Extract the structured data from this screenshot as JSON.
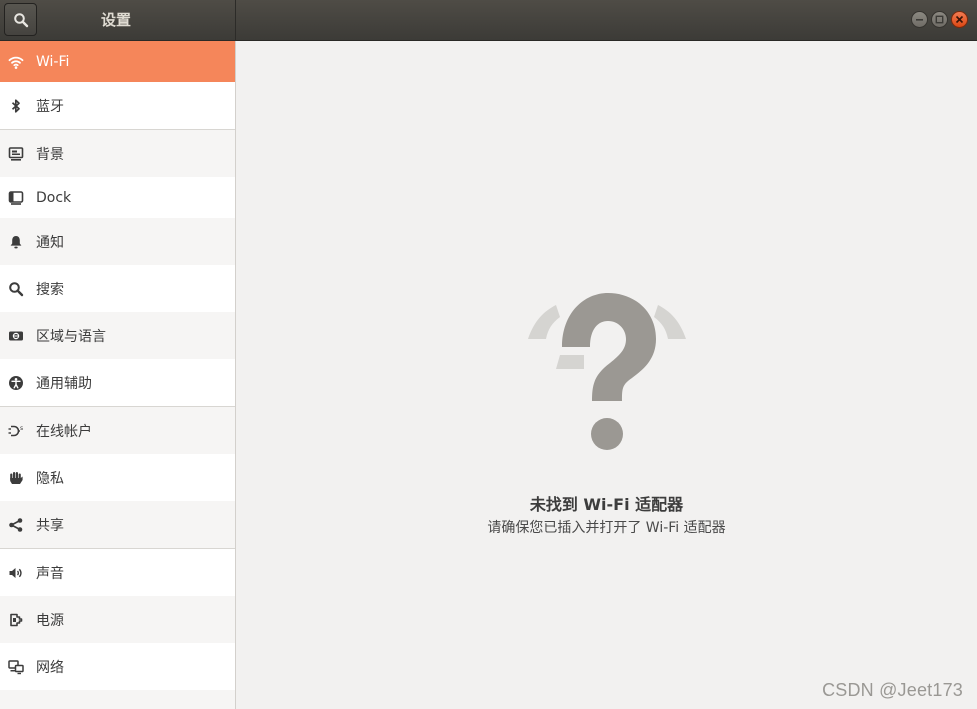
{
  "window": {
    "title": "设置"
  },
  "sidebar": {
    "items": [
      {
        "label": "Wi-Fi",
        "icon": "wifi-icon"
      },
      {
        "label": "蓝牙",
        "icon": "bluetooth-icon"
      },
      {
        "label": "背景",
        "icon": "background-icon"
      },
      {
        "label": "Dock",
        "icon": "dock-icon"
      },
      {
        "label": "通知",
        "icon": "bell-icon"
      },
      {
        "label": "搜索",
        "icon": "search-icon"
      },
      {
        "label": "区域与语言",
        "icon": "region-icon"
      },
      {
        "label": "通用辅助",
        "icon": "accessibility-icon"
      },
      {
        "label": "在线帐户",
        "icon": "online-accounts-icon"
      },
      {
        "label": "隐私",
        "icon": "hand-icon"
      },
      {
        "label": "共享",
        "icon": "share-icon"
      },
      {
        "label": "声音",
        "icon": "speaker-icon"
      },
      {
        "label": "电源",
        "icon": "power-plug-icon"
      },
      {
        "label": "网络",
        "icon": "network-icon"
      }
    ],
    "active_index": 0
  },
  "main": {
    "empty_icon": "question-mark-icon",
    "title": "未找到 Wi-Fi 适配器",
    "subtitle": "请确保您已插入并打开了 Wi-Fi 适配器"
  },
  "watermark": "CSDN @Jeet173",
  "colors": {
    "accent": "#f5865a",
    "header": "#3c3b37",
    "close": "#dd4814",
    "background": "#f2f1f0"
  }
}
